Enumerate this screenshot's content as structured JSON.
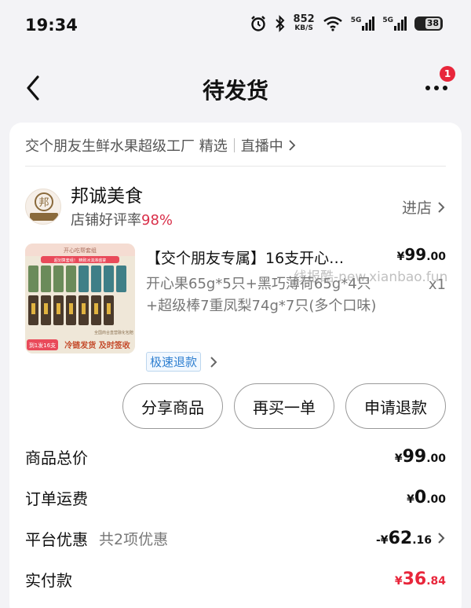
{
  "status_bar": {
    "time": "19:34",
    "net_speed": "852",
    "net_unit": "KB/S",
    "signal1": "5G",
    "signal2": "5G",
    "battery": "38"
  },
  "nav": {
    "title": "待发货",
    "notification_count": "1"
  },
  "source": {
    "channel": "交个朋友生鲜水果超级工厂 精选",
    "live": "直播中"
  },
  "shop": {
    "name": "邦诚美食",
    "rating_label": "店铺好评率",
    "rating_value": "98%",
    "enter_label": "进店"
  },
  "product": {
    "title": "【交个朋友专属】16支开心…",
    "price_symbol": "¥",
    "price_int": "99",
    "price_dec": ".00",
    "spec": "开心果65g*5只+黑巧薄荷65g*4只+超级棒7重凤梨74g*7只(多个口味)",
    "quantity": "x1",
    "refund_tag": "极速退款",
    "watermark": "线报酷-new.xianbao.fun"
  },
  "thumbnail": {
    "header": "开心吃帮套组",
    "promo1": "超划算套组！ 精致冰淇淋盛宴",
    "badge": "到1发16支",
    "footer": "冷链发货 及时签收",
    "side1": "全国商合直营",
    "side2": "融化包赔"
  },
  "actions": {
    "share": "分享商品",
    "rebuy": "再买一单",
    "refund": "申请退款"
  },
  "summary": {
    "total_label": "商品总价",
    "total_int": "99",
    "total_dec": ".00",
    "shipping_label": "订单运费",
    "shipping_int": "0",
    "shipping_dec": ".00",
    "discount_label": "平台优惠",
    "discount_sub": "共2项优惠",
    "discount_prefix": "-¥",
    "discount_int": "62",
    "discount_dec": ".16",
    "paid_label": "实付款",
    "paid_int": "36",
    "paid_dec": ".84",
    "currency": "¥"
  },
  "colors": {
    "accent_red": "#e8263b",
    "rating_pink": "#d9304a",
    "refund_blue": "#2f7fd0"
  }
}
